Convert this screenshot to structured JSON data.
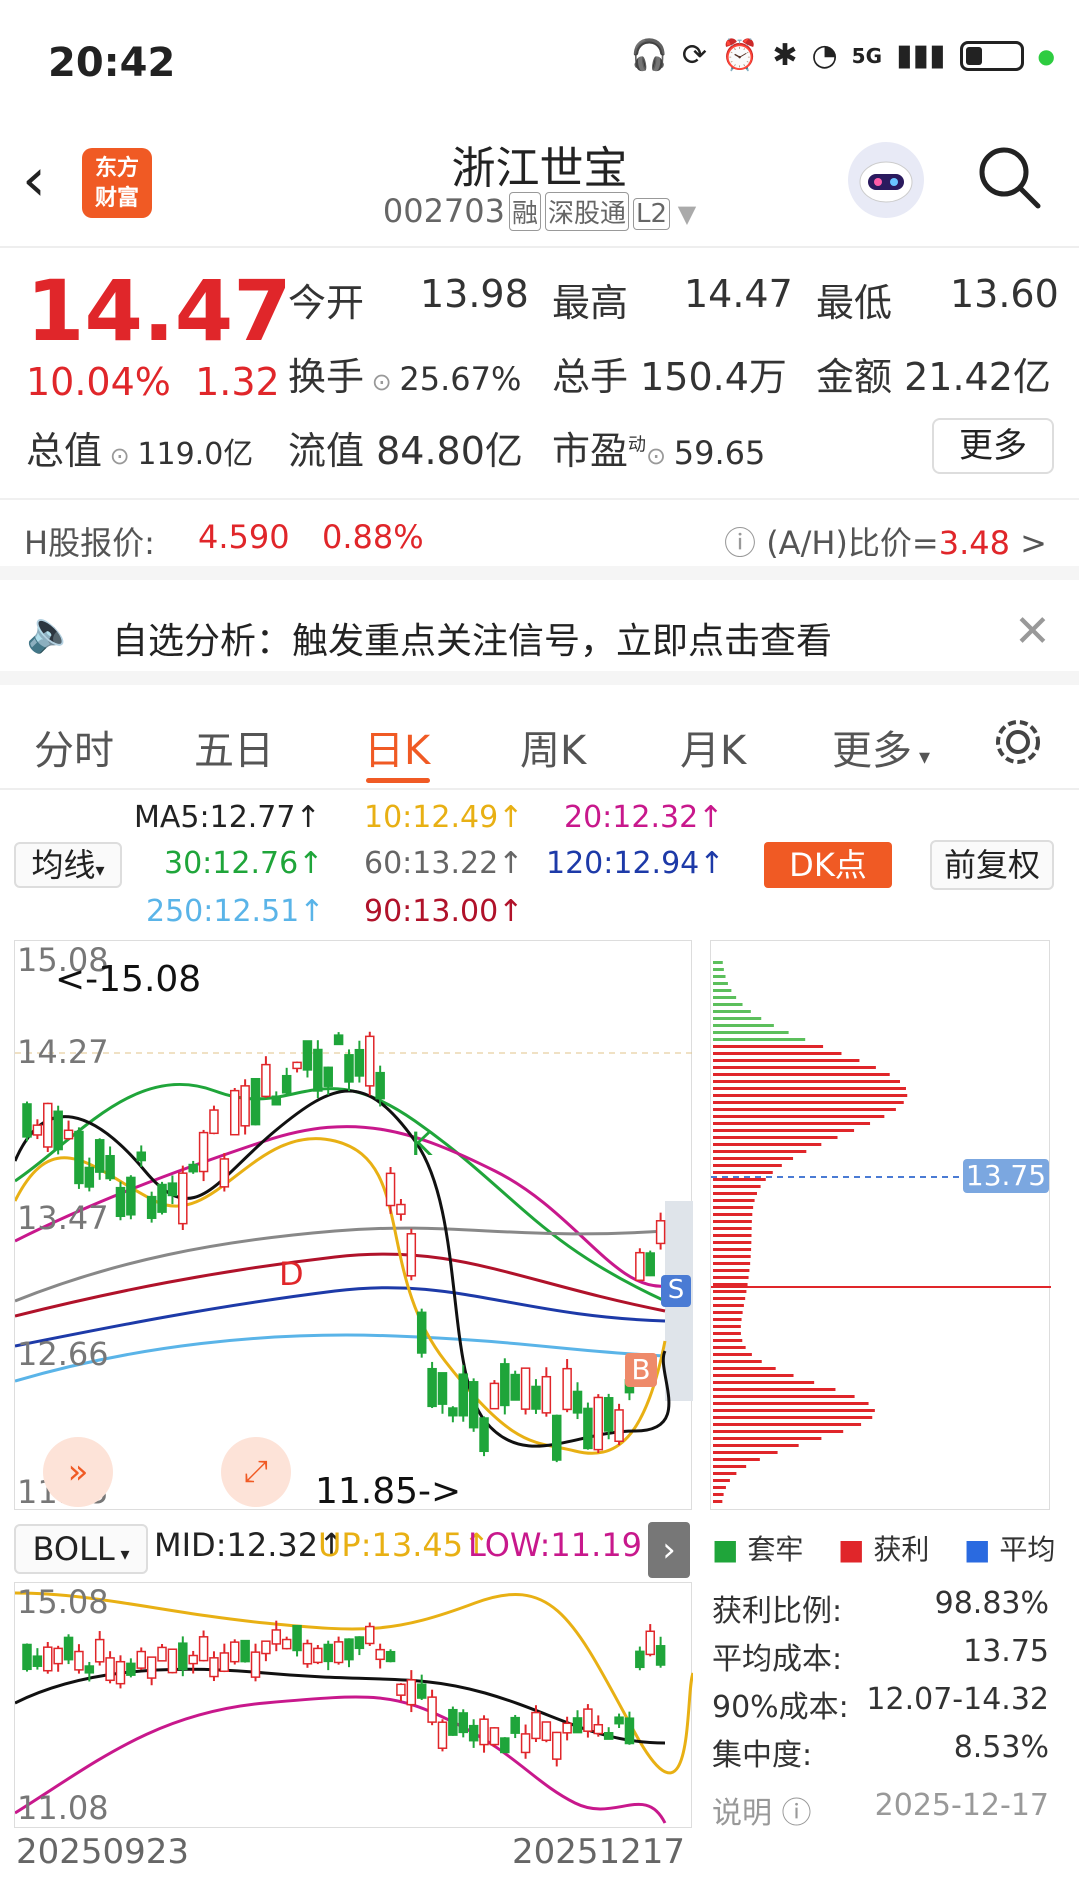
{
  "status_bar": {
    "time": "20:42",
    "network": "5G"
  },
  "header": {
    "title": "浙江世宝",
    "code": "002703",
    "tags": [
      "融",
      "深股通",
      "L2"
    ],
    "logo_line1": "东方",
    "logo_line2": "财富"
  },
  "quote": {
    "price": "14.47",
    "change_pct": "10.04%",
    "change": "1.32",
    "open_label": "今开",
    "open": "13.98",
    "high_label": "最高",
    "high": "14.47",
    "low_label": "最低",
    "low": "13.60",
    "turnover_label": "换手",
    "turnover": "25.67%",
    "volume_label": "总手",
    "volume": "150.4万",
    "amount_label": "金额",
    "amount": "21.42亿",
    "mktcap_label": "总值",
    "mktcap": "119.0亿",
    "float_label": "流值",
    "float": "84.80亿",
    "pe_label": "市盈",
    "pe_sup": "动",
    "pe": "59.65",
    "more": "更多"
  },
  "hshare": {
    "label": "H股报价:",
    "price": "4.590",
    "pct": "0.88%",
    "ah_label": "(A/H)比价=",
    "ah_value": "3.48"
  },
  "notice": {
    "text": "自选分析：触发重点关注信号，立即点击查看"
  },
  "tabs": [
    "分时",
    "五日",
    "日K",
    "周K",
    "月K",
    "更多"
  ],
  "ma": {
    "selector": "均线",
    "ma5": "MA5:12.77↑",
    "ma10": "10:12.49↑",
    "ma20": "20:12.32↑",
    "ma30": "30:12.76↑",
    "ma60": "60:13.22↑",
    "ma120": "120:12.94↑",
    "ma250": "250:12.51↑",
    "ma90": "90:13.00↑",
    "dk": "DK点",
    "fq": "前复权"
  },
  "main_chart": {
    "y_labels": [
      "15.08",
      "14.27",
      "13.47",
      "12.66",
      "11.85"
    ],
    "high_marker": "<-15.08",
    "low_marker": "11.85->",
    "letters": [
      "K",
      "D",
      "S",
      "B"
    ]
  },
  "dist": {
    "avg_label": "13.75"
  },
  "legend": {
    "a": "套牢",
    "b": "获利",
    "c": "平均"
  },
  "stats": [
    {
      "k": "获利比例:",
      "v": "98.83%"
    },
    {
      "k": "平均成本:",
      "v": "13.75"
    },
    {
      "k": "90%成本:",
      "v": "12.07-14.32"
    },
    {
      "k": "集中度:",
      "v": "8.53%"
    }
  ],
  "explain": {
    "label": "说明",
    "date": "2025-12-17"
  },
  "boll": {
    "selector": "BOLL",
    "mid": "MID:12.32↑",
    "up": "UP:13.45↑",
    "low": "LOW:11.19↓",
    "y_top": "15.08",
    "y_bottom": "11.08"
  },
  "x_axis": {
    "start": "20250923",
    "end": "20251217"
  },
  "colors": {
    "up": "#e0262a",
    "down": "#1fa53a",
    "accent": "#f05a24"
  }
}
